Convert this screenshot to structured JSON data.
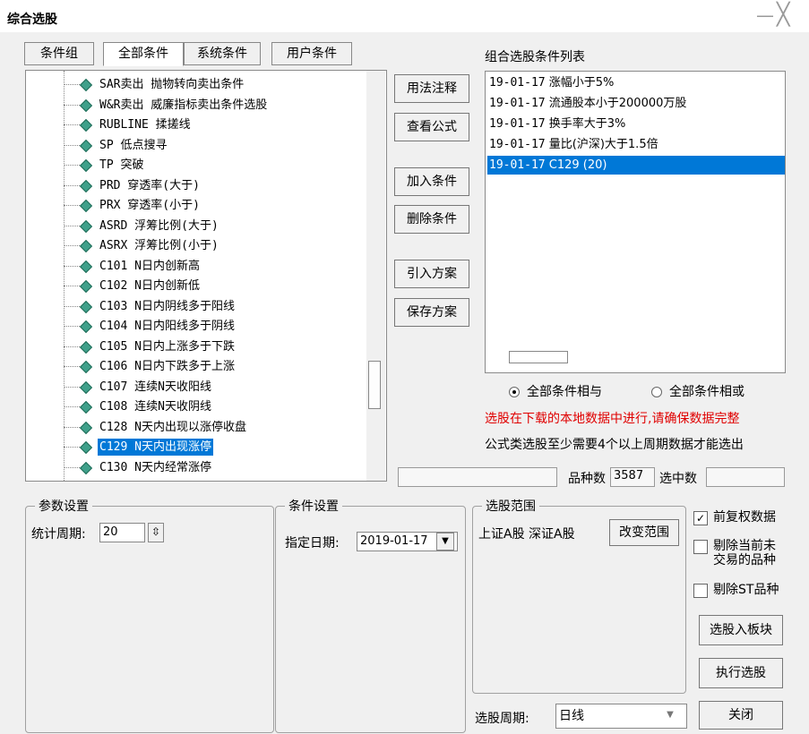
{
  "window": {
    "title": "综合选股",
    "minimize_glyph": "—",
    "close_glyph": "╳"
  },
  "tabs": [
    {
      "label": "条件组",
      "active": false
    },
    {
      "label": "全部条件",
      "active": true
    },
    {
      "label": "系统条件",
      "active": false
    },
    {
      "label": "用户条件",
      "active": false
    }
  ],
  "tree": {
    "items": [
      {
        "label": "SAR卖出 抛物转向卖出条件",
        "selected": false
      },
      {
        "label": "W&R卖出 威廉指标卖出条件选股",
        "selected": false
      },
      {
        "label": "RUBLINE 揉搓线",
        "selected": false
      },
      {
        "label": "SP 低点搜寻",
        "selected": false
      },
      {
        "label": "TP 突破",
        "selected": false
      },
      {
        "label": "PRD 穿透率(大于)",
        "selected": false
      },
      {
        "label": "PRX 穿透率(小于)",
        "selected": false
      },
      {
        "label": "ASRD 浮筹比例(大于)",
        "selected": false
      },
      {
        "label": "ASRX 浮筹比例(小于)",
        "selected": false
      },
      {
        "label": "C101 N日内创新高",
        "selected": false
      },
      {
        "label": "C102 N日内创新低",
        "selected": false
      },
      {
        "label": "C103 N日内阴线多于阳线",
        "selected": false
      },
      {
        "label": "C104 N日内阳线多于阴线",
        "selected": false
      },
      {
        "label": "C105 N日内上涨多于下跌",
        "selected": false
      },
      {
        "label": "C106 N日内下跌多于上涨",
        "selected": false
      },
      {
        "label": "C107 连续N天收阳线",
        "selected": false
      },
      {
        "label": "C108 连续N天收阴线",
        "selected": false
      },
      {
        "label": "C128 N天内出现以涨停收盘",
        "selected": false
      },
      {
        "label": "C129 N天内出现涨停",
        "selected": true
      },
      {
        "label": "C130 N天内经常涨停",
        "selected": false
      }
    ]
  },
  "middle_buttons": {
    "usage": "用法注释",
    "view_formula": "查看公式",
    "add": "加入条件",
    "delete": "删除条件",
    "import": "引入方案",
    "save": "保存方案"
  },
  "condition_list": {
    "label": "组合选股条件列表",
    "items": [
      {
        "date": "19-01-17",
        "text": "涨幅小于5%",
        "selected": false
      },
      {
        "date": "19-01-17",
        "text": "流通股本小于200000万股",
        "selected": false
      },
      {
        "date": "19-01-17",
        "text": "换手率大于3%",
        "selected": false
      },
      {
        "date": "19-01-17",
        "text": "量比(沪深)大于1.5倍",
        "selected": false
      },
      {
        "date": "19-01-17",
        "text": "C129 (20)",
        "selected": true
      }
    ]
  },
  "logic": {
    "and_label": "全部条件相与",
    "or_label": "全部条件相或",
    "selected": "and"
  },
  "notes": {
    "warning": "选股在下载的本地数据中进行,请确保数据完整",
    "info": "公式类选股至少需要4个以上周期数据才能选出"
  },
  "status": {
    "count_label": "品种数",
    "count_value": "3587",
    "selected_label": "选中数",
    "selected_value": ""
  },
  "params": {
    "group_title": "参数设置",
    "period_label": "统计周期:",
    "period_value": "20"
  },
  "conditions": {
    "group_title": "条件设置",
    "date_label": "指定日期:",
    "date_value": "2019-01-17"
  },
  "scope": {
    "group_title": "选股范围",
    "value": "上证A股 深证A股",
    "change_button": "改变范围",
    "period_label": "选股周期:",
    "period_value": "日线"
  },
  "options": {
    "adjusted": {
      "label": "前复权数据",
      "checked": true
    },
    "exclude_suspended": {
      "label_line1": "剔除当前未",
      "label_line2": "交易的品种",
      "checked": false
    },
    "exclude_st": {
      "label": "剔除ST品种",
      "checked": false
    }
  },
  "actions": {
    "to_block": "选股入板块",
    "run": "执行选股",
    "close": "关闭"
  }
}
